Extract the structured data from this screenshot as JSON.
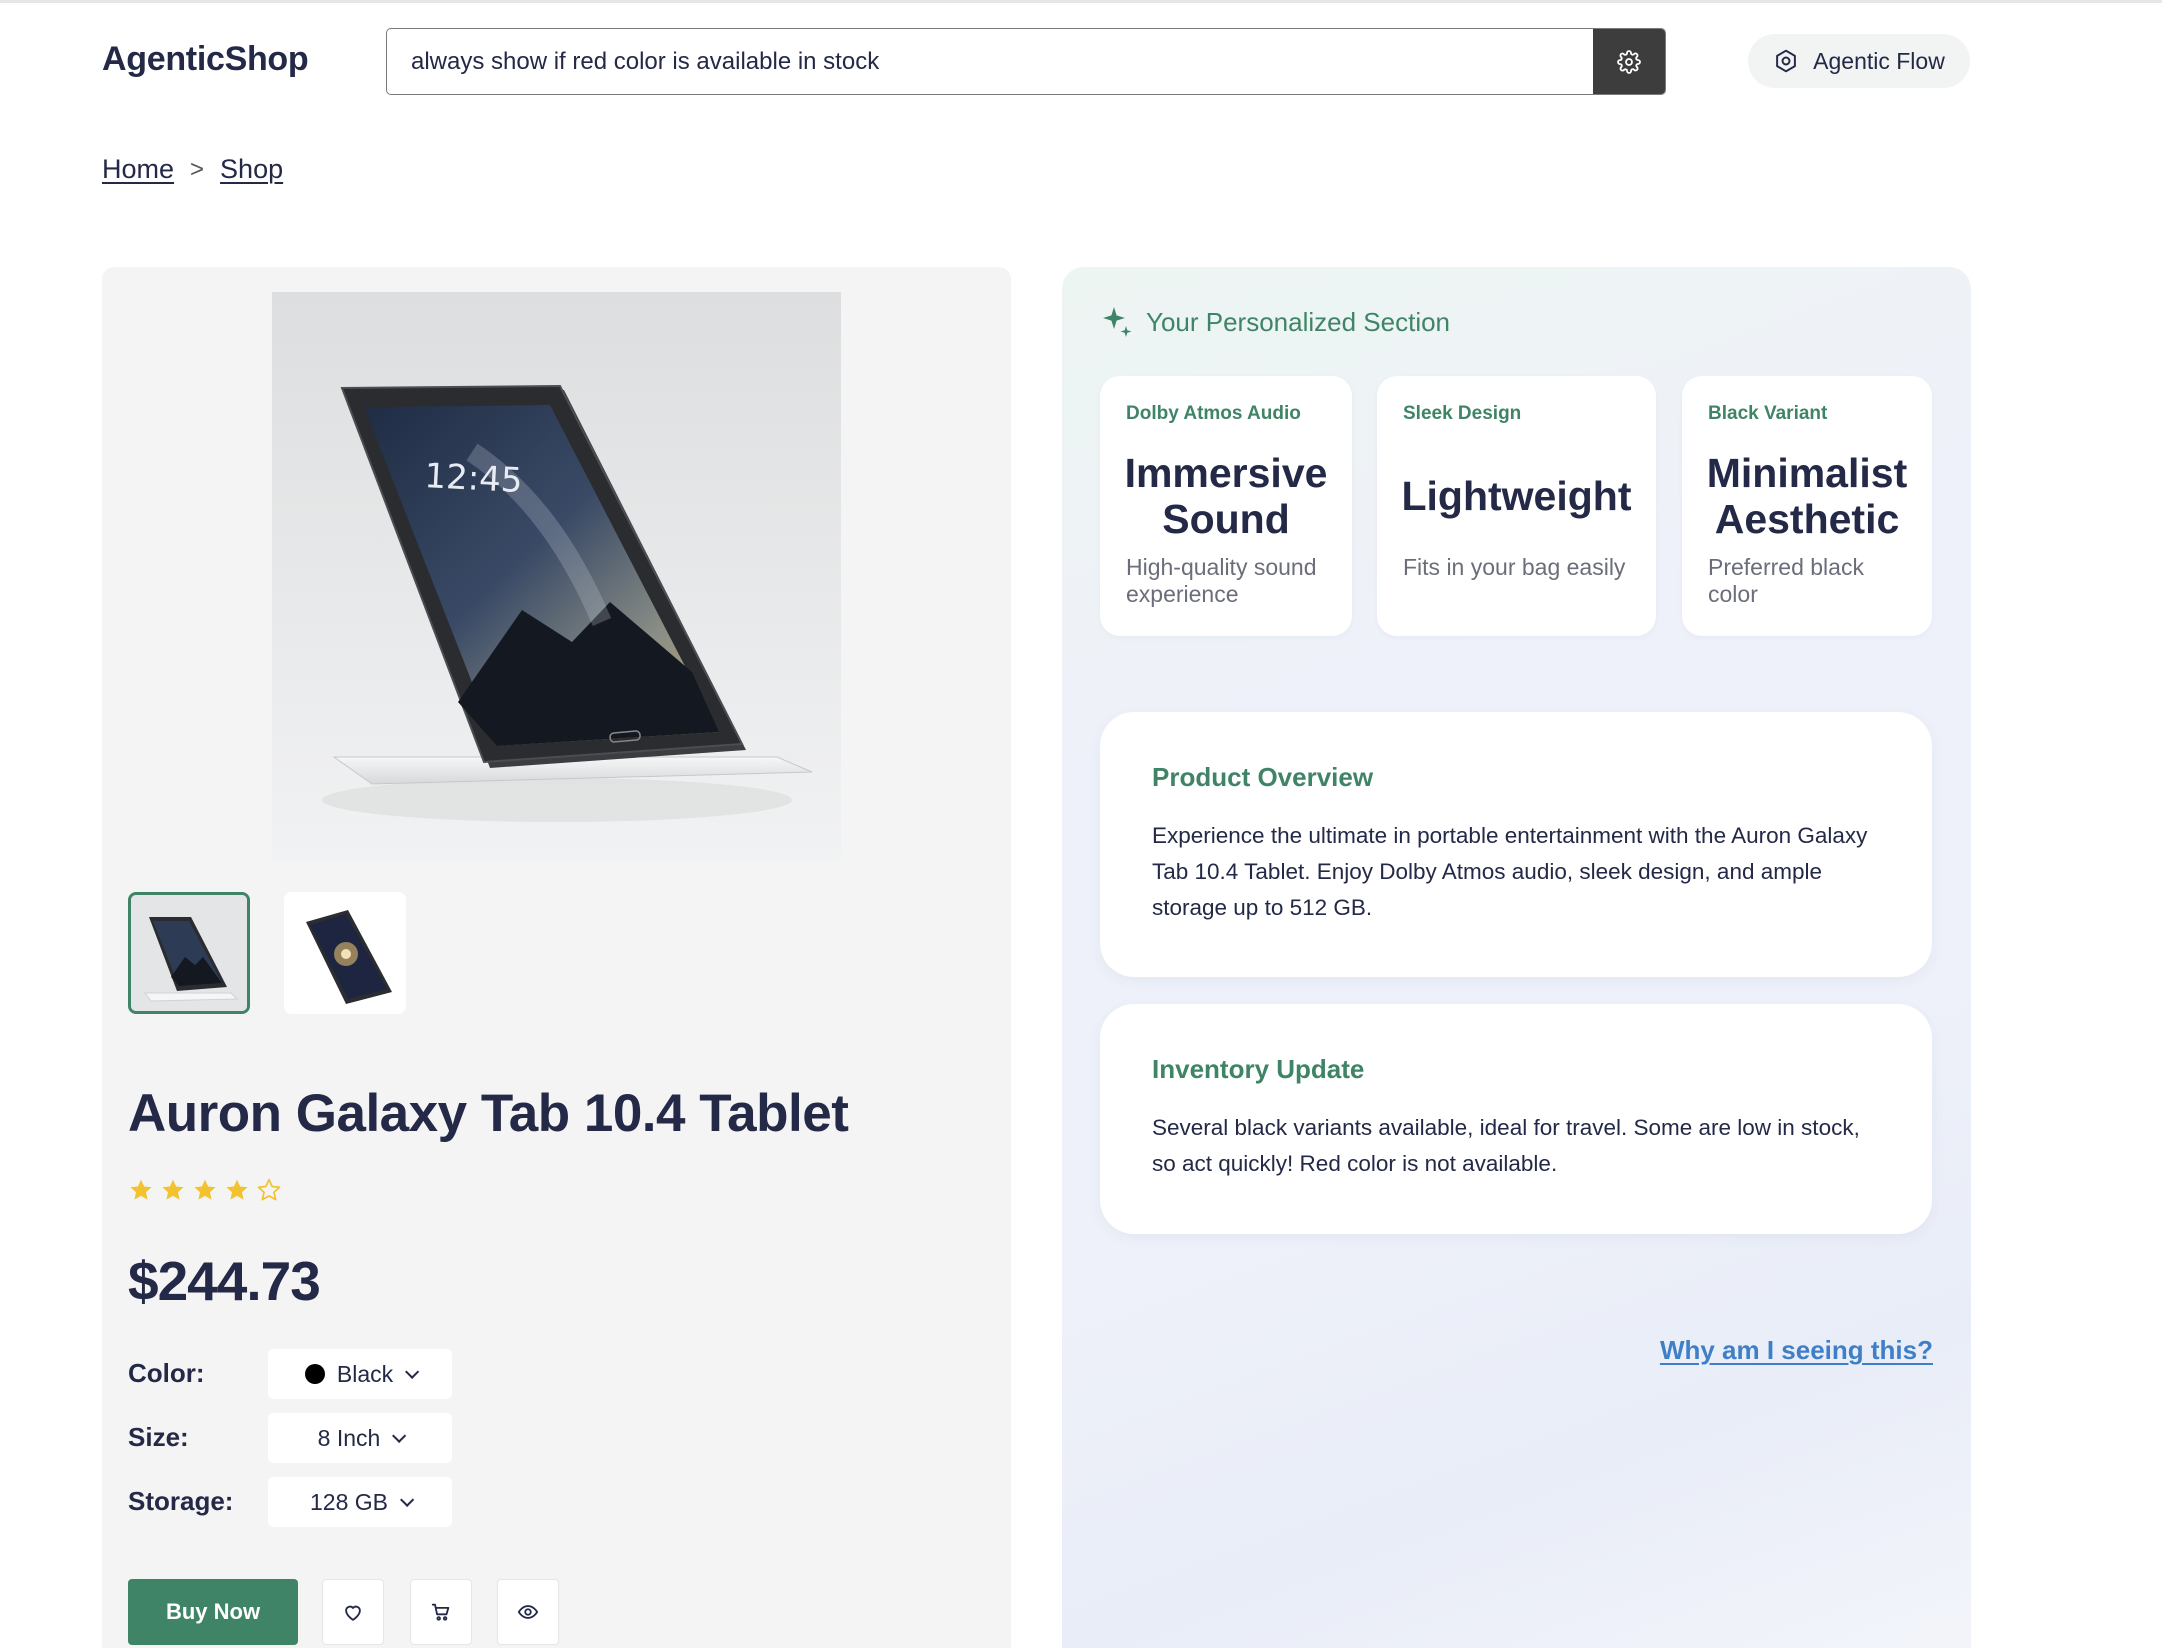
{
  "header": {
    "logo": "AgenticShop",
    "search": {
      "value": "always show if red color is available in stock",
      "placeholder": ""
    },
    "search_button_icon": "gear-icon",
    "agentic_flow_label": "Agentic Flow",
    "agentic_flow_icon": "hexagon-gear-icon"
  },
  "breadcrumb": {
    "items": [
      "Home",
      "Shop"
    ],
    "separator": ">"
  },
  "product": {
    "title": "Auron Galaxy Tab 10.4 Tablet",
    "rating": {
      "value": 4,
      "max": 5
    },
    "price": "$244.73",
    "options": {
      "color": {
        "label": "Color:",
        "value": "Black",
        "swatch": "#000000"
      },
      "size": {
        "label": "Size:",
        "value": "8 Inch"
      },
      "storage": {
        "label": "Storage:",
        "value": "128 GB"
      }
    },
    "tablet_screen_time": "12:45",
    "buy_label": "Buy Now",
    "action_icons": [
      "heart-icon",
      "cart-icon",
      "eye-icon"
    ]
  },
  "personalized": {
    "heading": "Your Personalized Section",
    "features": [
      {
        "tag": "Dolby Atmos Audio",
        "title": "Immersive Sound",
        "desc": "High-quality sound experience"
      },
      {
        "tag": "Sleek Design",
        "title": "Lightweight",
        "desc": "Fits in your bag easily"
      },
      {
        "tag": "Black Variant",
        "title": "Minimalist Aesthetic",
        "desc": "Preferred black color"
      }
    ],
    "overview": {
      "title": "Product Overview",
      "body": "Experience the ultimate in portable entertainment with the Auron Galaxy Tab 10.4 Tablet. Enjoy Dolby Atmos audio, sleek design, and ample storage up to 512 GB."
    },
    "inventory": {
      "title": "Inventory Update",
      "body": "Several black variants available, ideal for travel. Some are low in stock, so act quickly! Red color is not available."
    },
    "why_link": "Why am I seeing this?"
  },
  "colors": {
    "accent_green": "#3f8466",
    "text_dark": "#232946",
    "link_blue": "#3f7fc7",
    "star_gold": "#f2c230"
  }
}
